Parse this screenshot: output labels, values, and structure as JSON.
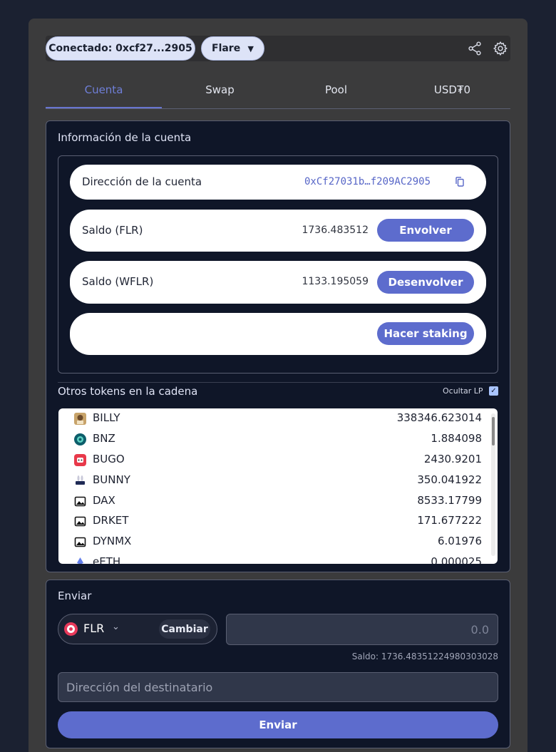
{
  "header": {
    "connected_label": "Conectado: 0xcf27...2905",
    "network_label": "Flare",
    "share_icon": "share-icon",
    "settings_icon": "gear-icon"
  },
  "tabs": [
    {
      "label": "Cuenta",
      "active": true
    },
    {
      "label": "Swap",
      "active": false
    },
    {
      "label": "Pool",
      "active": false
    },
    {
      "label": "USD₮0",
      "active": false
    }
  ],
  "account": {
    "title": "Información de la cuenta",
    "address_label": "Dirección de la cuenta",
    "address_value": "0xCf27031b…f209AC2905",
    "balance_flr_label": "Saldo (FLR)",
    "balance_flr_value": "1736.483512",
    "wrap_button": "Envolver",
    "balance_wflr_label": "Saldo (WFLR)",
    "balance_wflr_value": "1133.195059",
    "unwrap_button": "Desenvolver",
    "stake_button": "Hacer staking"
  },
  "other_tokens": {
    "title": "Otros tokens en la cadena",
    "hide_lp_label": "Ocultar LP",
    "hide_lp_checked": true,
    "tokens": [
      {
        "name": "BILLY",
        "value": "338346.623014"
      },
      {
        "name": "BNZ",
        "value": "1.884098"
      },
      {
        "name": "BUGO",
        "value": "2430.9201"
      },
      {
        "name": "BUNNY",
        "value": "350.041922"
      },
      {
        "name": "DAX",
        "value": "8533.17799"
      },
      {
        "name": "DRKET",
        "value": "171.677222"
      },
      {
        "name": "DYNMX",
        "value": "6.01976"
      },
      {
        "name": "eETH",
        "value": "0.000025"
      }
    ]
  },
  "send": {
    "title": "Enviar",
    "token": "FLR",
    "change_button": "Cambiar",
    "amount_placeholder": "0.0",
    "balance_note": "Saldo: 1736.48351224980303028",
    "recipient_placeholder": "Dirección del destinatario",
    "send_button": "Enviar"
  },
  "colors": {
    "accent": "#5d6ccd",
    "background": "#0f1628",
    "flare_red": "#e8395a"
  }
}
